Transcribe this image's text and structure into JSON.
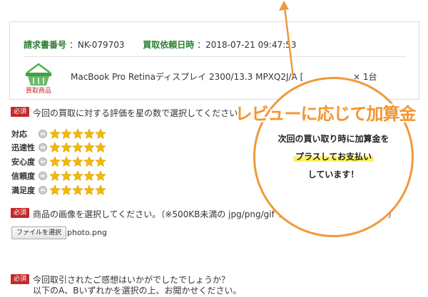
{
  "order": {
    "request_no_label": "請求書番号",
    "request_no_value": "：NK-079703",
    "datetime_label": "買取依頼日時",
    "datetime_value": "：2018-07-21 09:47:53",
    "product_icon_text": "買取商品",
    "product_name": "MacBook Pro Retinaディスプレイ 2300/13.3 MPXQ2J/A [",
    "quantity": "× 1台"
  },
  "required_badge": "必須",
  "rating_section": {
    "question": "今回の買取に対する評価を星の数で選択してください",
    "rows": [
      {
        "label": "対応",
        "stars": 5
      },
      {
        "label": "迅速性",
        "stars": 5
      },
      {
        "label": "安心度",
        "stars": 5
      },
      {
        "label": "信頼度",
        "stars": 5
      },
      {
        "label": "満足度",
        "stars": 5
      }
    ]
  },
  "image_section": {
    "question": "商品の画像を選択してください。（※500KB未満の jpg/png/gif ファイルを指定してください）",
    "file_button": "ファイルを選択",
    "file_name": "photo.png"
  },
  "comment_section": {
    "question_line1": "今回取引されたご感想はいかがでしたでしょうか？",
    "question_line2": "以下のA、Bいずれかを選択の上、お聞かせください。"
  },
  "promo": {
    "headline": "レビューに応じて加算金",
    "line1": "次回の買い取り時に加算金を",
    "line2": "プラスしてお支払い",
    "line3": "しています！"
  },
  "colors": {
    "accent_orange": "#f39530",
    "label_green": "#2e7d32",
    "required_red": "#c62828",
    "star_gold": "#f5b800",
    "highlight_yellow": "#fff25a"
  }
}
